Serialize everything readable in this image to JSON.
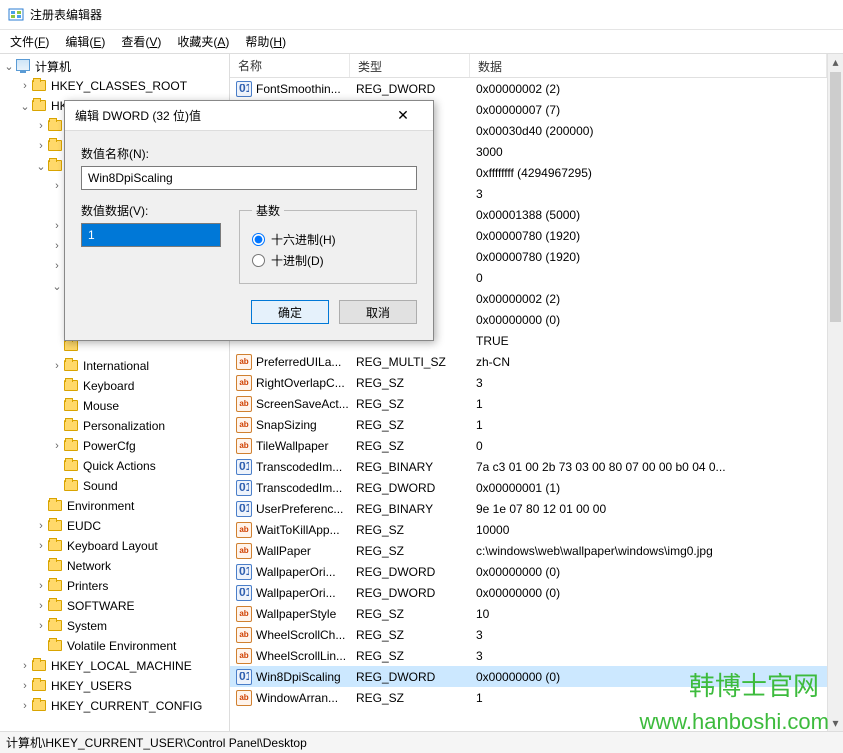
{
  "window": {
    "title": "注册表编辑器"
  },
  "menu": [
    {
      "label": "文件",
      "key": "F"
    },
    {
      "label": "编辑",
      "key": "E"
    },
    {
      "label": "查看",
      "key": "V"
    },
    {
      "label": "收藏夹",
      "key": "A"
    },
    {
      "label": "帮助",
      "key": "H"
    }
  ],
  "tree": [
    {
      "depth": 0,
      "exp": "open",
      "icon": "pc",
      "label": "计算机"
    },
    {
      "depth": 1,
      "exp": "closed",
      "icon": "folder",
      "label": "HKEY_CLASSES_ROOT"
    },
    {
      "depth": 1,
      "exp": "open",
      "icon": "folder",
      "label": "HKEY_CURRENT_USER"
    },
    {
      "depth": 2,
      "exp": "closed",
      "icon": "folder",
      "label": ""
    },
    {
      "depth": 2,
      "exp": "closed",
      "icon": "folder",
      "label": ""
    },
    {
      "depth": 2,
      "exp": "open",
      "icon": "folder",
      "label": ""
    },
    {
      "depth": 3,
      "exp": "closed",
      "icon": "folder",
      "label": ""
    },
    {
      "depth": 3,
      "exp": "none",
      "icon": "folder",
      "label": ""
    },
    {
      "depth": 3,
      "exp": "closed",
      "icon": "folder",
      "label": ""
    },
    {
      "depth": 3,
      "exp": "closed",
      "icon": "folder",
      "label": ""
    },
    {
      "depth": 3,
      "exp": "closed",
      "icon": "folder",
      "label": ""
    },
    {
      "depth": 3,
      "exp": "open",
      "icon": "folder",
      "label": ""
    },
    {
      "depth": 4,
      "exp": "none",
      "icon": "folder",
      "label": ""
    },
    {
      "depth": 4,
      "exp": "none",
      "icon": "folder",
      "label": ""
    },
    {
      "depth": 3,
      "exp": "none",
      "icon": "folder",
      "label": ""
    },
    {
      "depth": 3,
      "exp": "closed",
      "icon": "folder",
      "label": "International"
    },
    {
      "depth": 3,
      "exp": "none",
      "icon": "folder",
      "label": "Keyboard"
    },
    {
      "depth": 3,
      "exp": "none",
      "icon": "folder",
      "label": "Mouse"
    },
    {
      "depth": 3,
      "exp": "none",
      "icon": "folder",
      "label": "Personalization"
    },
    {
      "depth": 3,
      "exp": "closed",
      "icon": "folder",
      "label": "PowerCfg"
    },
    {
      "depth": 3,
      "exp": "none",
      "icon": "folder",
      "label": "Quick Actions"
    },
    {
      "depth": 3,
      "exp": "none",
      "icon": "folder",
      "label": "Sound"
    },
    {
      "depth": 2,
      "exp": "none",
      "icon": "folder",
      "label": "Environment"
    },
    {
      "depth": 2,
      "exp": "closed",
      "icon": "folder",
      "label": "EUDC"
    },
    {
      "depth": 2,
      "exp": "closed",
      "icon": "folder",
      "label": "Keyboard Layout"
    },
    {
      "depth": 2,
      "exp": "none",
      "icon": "folder",
      "label": "Network"
    },
    {
      "depth": 2,
      "exp": "closed",
      "icon": "folder",
      "label": "Printers"
    },
    {
      "depth": 2,
      "exp": "closed",
      "icon": "folder",
      "label": "SOFTWARE"
    },
    {
      "depth": 2,
      "exp": "closed",
      "icon": "folder",
      "label": "System"
    },
    {
      "depth": 2,
      "exp": "none",
      "icon": "folder",
      "label": "Volatile Environment"
    },
    {
      "depth": 1,
      "exp": "closed",
      "icon": "folder",
      "label": "HKEY_LOCAL_MACHINE"
    },
    {
      "depth": 1,
      "exp": "closed",
      "icon": "folder",
      "label": "HKEY_USERS"
    },
    {
      "depth": 1,
      "exp": "closed",
      "icon": "folder",
      "label": "HKEY_CURRENT_CONFIG"
    }
  ],
  "columns": {
    "name": "名称",
    "type": "类型",
    "data": "数据"
  },
  "values": [
    {
      "icon": "bin",
      "name": "FontSmoothin...",
      "type": "REG_DWORD",
      "data": "0x00000002 (2)"
    },
    {
      "icon": "blank",
      "name": "",
      "type": "",
      "data": "0x00000007 (7)"
    },
    {
      "icon": "blank",
      "name": "",
      "type": "",
      "data": "0x00030d40 (200000)"
    },
    {
      "icon": "blank",
      "name": "",
      "type": "",
      "data": "3000"
    },
    {
      "icon": "blank",
      "name": "",
      "type": "",
      "data": "0xffffffff (4294967295)"
    },
    {
      "icon": "blank",
      "name": "",
      "type": "",
      "data": "3"
    },
    {
      "icon": "blank",
      "name": "",
      "type": "",
      "data": "0x00001388 (5000)"
    },
    {
      "icon": "blank",
      "name": "",
      "type": "",
      "data": "0x00000780 (1920)"
    },
    {
      "icon": "blank",
      "name": "",
      "type": "",
      "data": "0x00000780 (1920)"
    },
    {
      "icon": "blank",
      "name": "",
      "type": "",
      "data": "0"
    },
    {
      "icon": "blank",
      "name": "",
      "type": "",
      "data": "0x00000002 (2)"
    },
    {
      "icon": "blank",
      "name": "",
      "type": "",
      "data": "0x00000000 (0)"
    },
    {
      "icon": "blank",
      "name": "",
      "type": "",
      "data": "TRUE"
    },
    {
      "icon": "sz",
      "name": "PreferredUILa...",
      "type": "REG_MULTI_SZ",
      "data": "zh-CN"
    },
    {
      "icon": "sz",
      "name": "RightOverlapC...",
      "type": "REG_SZ",
      "data": "3"
    },
    {
      "icon": "sz",
      "name": "ScreenSaveAct...",
      "type": "REG_SZ",
      "data": "1"
    },
    {
      "icon": "sz",
      "name": "SnapSizing",
      "type": "REG_SZ",
      "data": "1"
    },
    {
      "icon": "sz",
      "name": "TileWallpaper",
      "type": "REG_SZ",
      "data": "0"
    },
    {
      "icon": "bin",
      "name": "TranscodedIm...",
      "type": "REG_BINARY",
      "data": "7a c3 01 00 2b 73 03 00 80 07 00 00 b0 04 0..."
    },
    {
      "icon": "bin",
      "name": "TranscodedIm...",
      "type": "REG_DWORD",
      "data": "0x00000001 (1)"
    },
    {
      "icon": "bin",
      "name": "UserPreferenc...",
      "type": "REG_BINARY",
      "data": "9e 1e 07 80 12 01 00 00"
    },
    {
      "icon": "sz",
      "name": "WaitToKillApp...",
      "type": "REG_SZ",
      "data": "10000"
    },
    {
      "icon": "sz",
      "name": "WallPaper",
      "type": "REG_SZ",
      "data": "c:\\windows\\web\\wallpaper\\windows\\img0.jpg"
    },
    {
      "icon": "bin",
      "name": "WallpaperOri...",
      "type": "REG_DWORD",
      "data": "0x00000000 (0)"
    },
    {
      "icon": "bin",
      "name": "WallpaperOri...",
      "type": "REG_DWORD",
      "data": "0x00000000 (0)"
    },
    {
      "icon": "sz",
      "name": "WallpaperStyle",
      "type": "REG_SZ",
      "data": "10"
    },
    {
      "icon": "sz",
      "name": "WheelScrollCh...",
      "type": "REG_SZ",
      "data": "3"
    },
    {
      "icon": "sz",
      "name": "WheelScrollLin...",
      "type": "REG_SZ",
      "data": "3"
    },
    {
      "icon": "bin",
      "name": "Win8DpiScaling",
      "type": "REG_DWORD",
      "data": "0x00000000 (0)",
      "selected": true
    },
    {
      "icon": "sz",
      "name": "WindowArran...",
      "type": "REG_SZ",
      "data": "1"
    }
  ],
  "statusbar": {
    "path": "计算机\\HKEY_CURRENT_USER\\Control Panel\\Desktop"
  },
  "dialog": {
    "title": "编辑 DWORD (32 位)值",
    "name_label": "数值名称(N):",
    "name_value": "Win8DpiScaling",
    "data_label": "数值数据(V):",
    "data_value": "1",
    "base_label": "基数",
    "radio_hex": "十六进制(H)",
    "radio_dec": "十进制(D)",
    "ok": "确定",
    "cancel": "取消"
  },
  "watermark": {
    "line1": "韩博士官网",
    "line2": "www.hanboshi.com"
  }
}
